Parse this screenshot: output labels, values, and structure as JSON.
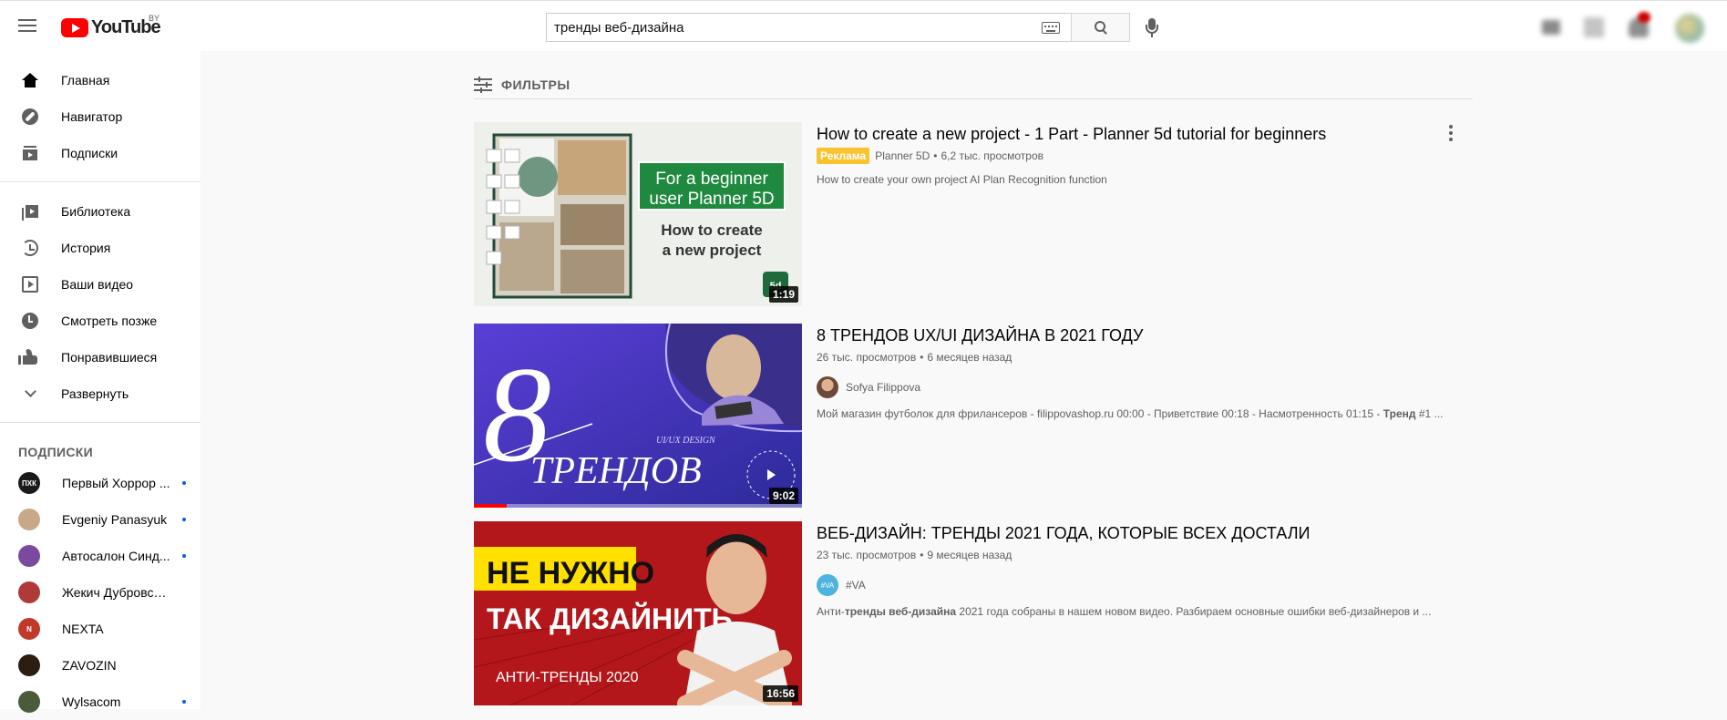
{
  "header": {
    "logo_text": "YouTube",
    "logo_region": "BY",
    "search_value": "тренды веб-дизайна"
  },
  "sidebar": {
    "primary": [
      {
        "label": "Главная",
        "icon": "home-icon"
      },
      {
        "label": "Навигатор",
        "icon": "compass-icon"
      },
      {
        "label": "Подписки",
        "icon": "subscriptions-icon"
      }
    ],
    "library": [
      {
        "label": "Библиотека",
        "icon": "library-icon"
      },
      {
        "label": "История",
        "icon": "history-icon"
      },
      {
        "label": "Ваши видео",
        "icon": "your-videos-icon"
      },
      {
        "label": "Смотреть позже",
        "icon": "watch-later-icon"
      },
      {
        "label": "Понравившиеся",
        "icon": "liked-icon"
      },
      {
        "label": "Развернуть",
        "icon": "chevron-down-icon"
      }
    ],
    "subscriptions_heading": "ПОДПИСКИ",
    "subscriptions": [
      {
        "label": "Первый Хоррор ...",
        "avatar_text": "ПХК",
        "avatar_color": "#1a1a1a",
        "new": true
      },
      {
        "label": "Evgeniy Panasyuk",
        "avatar_text": "",
        "avatar_color": "#c9a889",
        "new": true
      },
      {
        "label": "Автосалон Синд...",
        "avatar_text": "",
        "avatar_color": "#7a4a9e",
        "new": true
      },
      {
        "label": "Жекич Дубровский",
        "avatar_text": "",
        "avatar_color": "#b03a3a",
        "new": false
      },
      {
        "label": "NEXTA",
        "avatar_text": "N",
        "avatar_color": "#c0392b",
        "new": false
      },
      {
        "label": "ZAVOZIN",
        "avatar_text": "",
        "avatar_color": "#2b1d12",
        "new": false
      },
      {
        "label": "Wylsacom",
        "avatar_text": "",
        "avatar_color": "#4a5a3a",
        "new": true
      }
    ]
  },
  "filters": {
    "label": "ФИЛЬТРЫ"
  },
  "results": [
    {
      "title": "How to create a new project - 1 Part - Planner 5d tutorial for beginners",
      "ad_badge": "Реклама",
      "channel": "Planner 5D",
      "views": "6,2 тыс. просмотров",
      "description": "How to create your own project AI Plan Recognition function",
      "duration": "1:19",
      "thumb_line1": "For a beginner",
      "thumb_line2": "user Planner 5D",
      "thumb_line3": "How to create",
      "thumb_line4": "a new project",
      "thumb_badge": "5d"
    },
    {
      "title": "8 ТРЕНДОВ UX/UI ДИЗАЙНА В 2021 ГОДУ",
      "views": "26 тыс. просмотров",
      "age": "6 месяцев назад",
      "channel": "Sofya Filippova",
      "description_1": "Мой магазин футболок для фрилансеров - filippovashop.ru 00:00 - Приветствие 00:18 - Насмотренность 01:15 - ",
      "description_bold": "Тренд",
      "description_2": " #1 ...",
      "duration": "9:02",
      "thumb_number": "8",
      "thumb_small": "UI/UX DESIGN",
      "thumb_word": "ТРЕНДОВ",
      "watch_progress": 0.1
    },
    {
      "title": "ВЕБ-ДИЗАЙН: ТРЕНДЫ 2021 ГОДА, КОТОРЫЕ ВСЕХ ДОСТАЛИ",
      "views": "23 тыс. просмотров",
      "age": "9 месяцев назад",
      "channel": "#VA",
      "channel_avatar": "#VA",
      "description_1": "Анти-",
      "description_bold": "тренды веб-дизайна",
      "description_2": " 2021 года собраны в нашем новом видео. Разбираем основные ошибки веб-дизайнеров и ...",
      "duration": "16:56",
      "thumb_line1": "НЕ НУЖНО",
      "thumb_line2": "ТАК ДИЗАЙНИТЬ",
      "thumb_line3": "АНТИ-ТРЕНДЫ 2020"
    }
  ],
  "meta_separator": "•"
}
